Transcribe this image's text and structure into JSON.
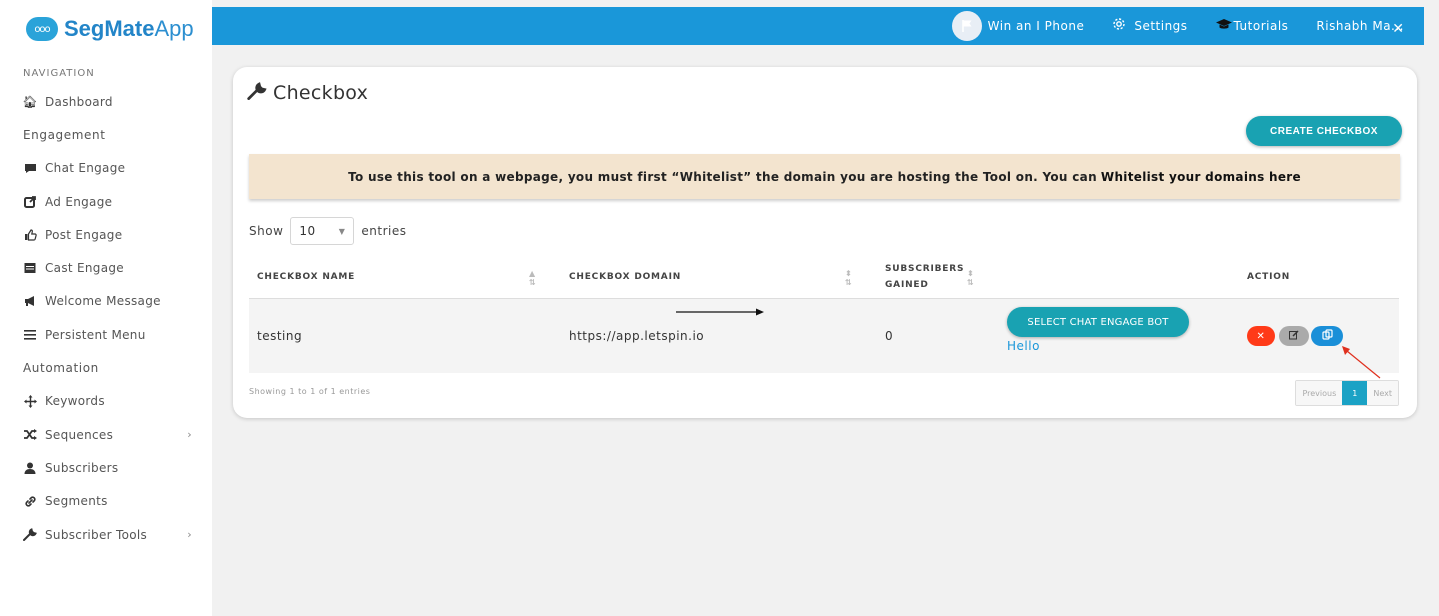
{
  "brand": {
    "logo_text": "ooo",
    "name_bold": "SegMate",
    "name_regular": "App"
  },
  "sidebar": {
    "heading": "NAVIGATION",
    "items": [
      {
        "label": "Dashboard",
        "icon": "home-icon"
      },
      {
        "label": "Engagement",
        "section": true
      },
      {
        "label": "Chat Engage",
        "icon": "chat-bubble-icon"
      },
      {
        "label": "Ad Engage",
        "icon": "share-icon"
      },
      {
        "label": "Post Engage",
        "icon": "thumbs-up-icon"
      },
      {
        "label": "Cast Engage",
        "icon": "calendar-icon"
      },
      {
        "label": "Welcome Message",
        "icon": "megaphone-icon"
      },
      {
        "label": "Persistent Menu",
        "icon": "bars-icon"
      },
      {
        "label": "Automation",
        "section": true
      },
      {
        "label": "Keywords",
        "icon": "arrows-icon"
      },
      {
        "label": "Sequences",
        "icon": "shuffle-icon",
        "chevron": "›"
      },
      {
        "label": "Subscribers",
        "icon": "user-icon"
      },
      {
        "label": "Segments",
        "icon": "link-icon"
      },
      {
        "label": "Subscriber Tools",
        "icon": "wrench-icon",
        "chevron": "›"
      }
    ]
  },
  "topbar": {
    "win_label": "Win an I Phone",
    "settings_label": "Settings",
    "tutorials_label": "Tutorials",
    "user_label": "Rishabh Ma...",
    "close_glyph": "✕",
    "bg_color": "#1a97d9"
  },
  "page": {
    "title": "Checkbox",
    "create_button": "CREATE CHECKBOX",
    "alert_text": "To use this tool on a webpage, you must first “Whitelist” the domain you are hosting the Tool on. You can",
    "alert_link": "Whitelist your domains here",
    "show_label": "Show",
    "entries_value": "10",
    "entries_label": "entries"
  },
  "table": {
    "headers": {
      "name": "CHECKBOX NAME",
      "domain": "CHECKBOX DOMAIN",
      "subscribers_line1": "SUBSCRIBERS",
      "subscribers_line2": "GAINED",
      "action": "ACTION"
    },
    "rows": [
      {
        "name": "testing",
        "domain": "https://app.letspin.io",
        "subscribers": "0",
        "select_bot_button": "SELECT CHAT ENGAGE BOT",
        "bot_text": "Hello",
        "actions": [
          "delete",
          "edit",
          "copy"
        ]
      }
    ],
    "info": "Showing 1 to 1 of 1 entries",
    "pagination": {
      "previous": "Previous",
      "current": "1",
      "next": "Next"
    }
  },
  "colors": {
    "accent": "#19a2b2",
    "danger": "#ff3a18",
    "primary": "#1a8fd8",
    "alert_bg": "#f3e4cf"
  }
}
